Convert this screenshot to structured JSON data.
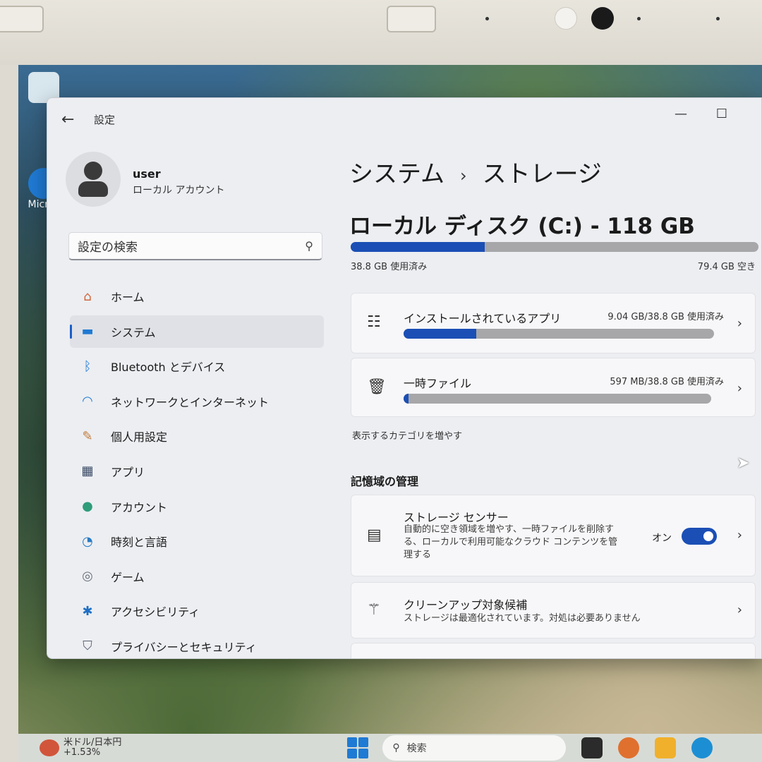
{
  "window": {
    "title": "設定",
    "back_icon": "back-arrow-icon",
    "minimize_glyph": "—",
    "maximize_glyph": "☐"
  },
  "profile": {
    "name": "user",
    "account_type": "ローカル アカウント"
  },
  "search": {
    "placeholder": "設定の検索"
  },
  "sidebar": {
    "items": [
      {
        "label": "ホーム",
        "icon": "home-icon",
        "glyph": "⌂",
        "color": "#d2643a",
        "active": false
      },
      {
        "label": "システム",
        "icon": "display-icon",
        "glyph": "▬",
        "color": "#1f7ad4",
        "active": true
      },
      {
        "label": "Bluetooth とデバイス",
        "icon": "bluetooth-icon",
        "glyph": "ᛒ",
        "color": "#1f7ad4",
        "active": false
      },
      {
        "label": "ネットワークとインターネット",
        "icon": "wifi-icon",
        "glyph": "◠",
        "color": "#1f7ad4",
        "active": false
      },
      {
        "label": "個人用設定",
        "icon": "brush-icon",
        "glyph": "✎",
        "color": "#c07a3a",
        "active": false
      },
      {
        "label": "アプリ",
        "icon": "apps-icon",
        "glyph": "▦",
        "color": "#3b4a66",
        "active": false
      },
      {
        "label": "アカウント",
        "icon": "account-icon",
        "glyph": "●",
        "color": "#2f9c7a",
        "active": false
      },
      {
        "label": "時刻と言語",
        "icon": "globe-clock-icon",
        "glyph": "◔",
        "color": "#2b7bc4",
        "active": false
      },
      {
        "label": "ゲーム",
        "icon": "gamepad-icon",
        "glyph": "◎",
        "color": "#6b6f7a",
        "active": false
      },
      {
        "label": "アクセシビリティ",
        "icon": "accessibility-icon",
        "glyph": "✱",
        "color": "#1f6fc4",
        "active": false
      },
      {
        "label": "プライバシーとセキュリティ",
        "icon": "shield-icon",
        "glyph": "⛉",
        "color": "#5a6070",
        "active": false
      }
    ]
  },
  "breadcrumb": {
    "parent": "システム",
    "separator": "›",
    "current": "ストレージ"
  },
  "disk": {
    "title": "ローカル ディスク (C:) - 118 GB",
    "used_label": "38.8 GB 使用済み",
    "free_label": "79.4 GB 空き",
    "used_fraction": 0.329
  },
  "categories": [
    {
      "title": "インストールされているアプリ",
      "meta": "9.04 GB/38.8 GB 使用済み",
      "icon": "list-icon",
      "glyph": "☷",
      "fraction": 0.233
    },
    {
      "title": "一時ファイル",
      "meta": "597 MB/38.8 GB 使用済み",
      "icon": "trash-icon",
      "glyph": "🗑",
      "fraction": 0.015
    }
  ],
  "more_categories_link": "表示するカテゴリを増やす",
  "management": {
    "title": "記憶域の管理",
    "storage_sense": {
      "title": "ストレージ センサー",
      "desc": "自動的に空き領域を増やす、一時ファイルを削除する、ローカルで利用可能なクラウド コンテンツを管理する",
      "toggle_label": "オン",
      "icon": "drive-icon"
    },
    "cleanup": {
      "title": "クリーンアップ対象候補",
      "desc": "ストレージは最適化されています。対処は必要ありません",
      "icon": "broom-icon"
    }
  },
  "desktop": {
    "icon_label": "Micros"
  },
  "taskbar": {
    "weather_title": "米ドル/日本円",
    "weather_value": "+1.53%",
    "search_placeholder": "検索"
  },
  "colors": {
    "accent": "#1b4fb5",
    "bar_track": "#a7a7a9"
  }
}
